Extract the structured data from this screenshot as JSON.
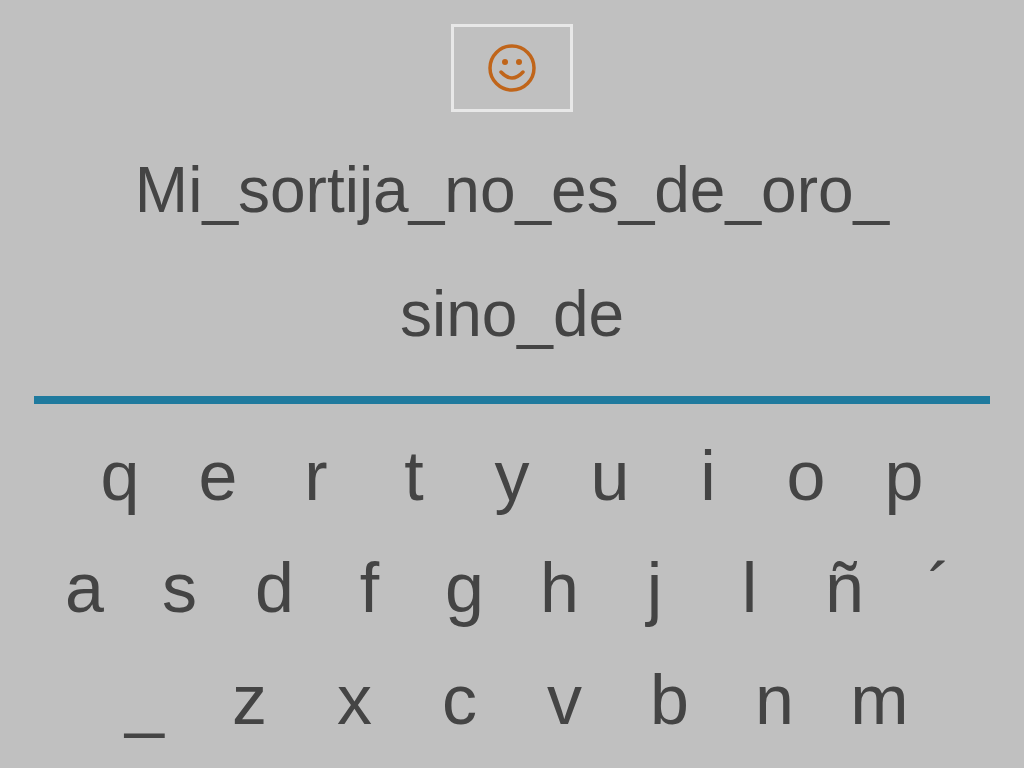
{
  "prompt": {
    "lines": [
      "Mi_sortija_no_es_de_oro_",
      "sino_de"
    ]
  },
  "keyboard": {
    "rows": [
      [
        "q",
        "e",
        "r",
        "t",
        "y",
        "u",
        "i",
        "o",
        "p"
      ],
      [
        "a",
        "s",
        "d",
        "f",
        "g",
        "h",
        "j",
        "l",
        "ñ",
        "´"
      ],
      [
        "_",
        "z",
        "x",
        "c",
        "v",
        "b",
        "n",
        "m"
      ]
    ]
  }
}
